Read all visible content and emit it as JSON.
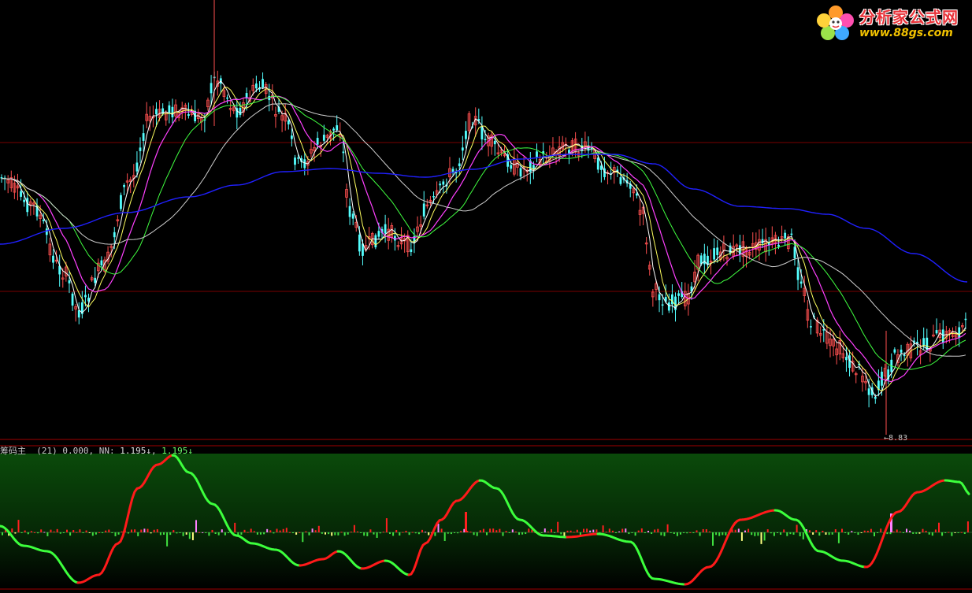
{
  "logo": {
    "title": "分析家公式网",
    "url": "www.88gs.com"
  },
  "indicator": {
    "name": "筹码主",
    "param": "(21)",
    "value1": "0.000,",
    "nn_label": "NN:",
    "nn_value": "1.195↓",
    "value3": "1.195↓"
  },
  "low_marker": "8.83",
  "colors": {
    "background": "#000000",
    "up_candle": "#ff5050",
    "down_candle": "#54ffff",
    "ma_white": "#ffffff",
    "ma_yellow": "#ffff60",
    "ma_magenta": "#ff40ff",
    "ma_green": "#40ff40",
    "ma_blue": "#2020ff",
    "ma_gray": "#d0d0d0",
    "grid_red": "#7a0000",
    "hist_red": "#ff2020",
    "hist_green": "#40e040",
    "hist_pink": "#ff80ff",
    "hist_yellow": "#ffff80",
    "curve_red": "#ff1a1a",
    "curve_green": "#3cff3c"
  },
  "chart_data": [
    {
      "type": "candlestick",
      "title": "",
      "min_price_label": "8.83",
      "moving_averages": [
        "white",
        "yellow",
        "magenta",
        "green",
        "gray",
        "blue"
      ]
    },
    {
      "type": "line",
      "title": "筹码主",
      "series": [
        {
          "name": "NN"
        }
      ]
    }
  ]
}
